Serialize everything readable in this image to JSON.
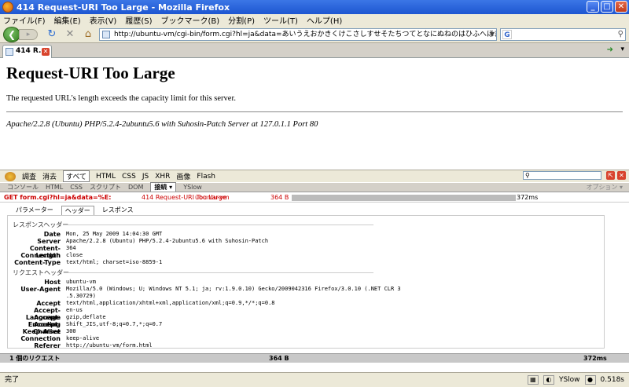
{
  "window": {
    "title": "414 Request-URI Too Large - Mozilla Firefox",
    "min": "_",
    "max": "□",
    "close": "✕"
  },
  "menu": [
    "ファイル(F)",
    "編集(E)",
    "表示(V)",
    "履歴(S)",
    "ブックマーク(B)",
    "分割(P)",
    "ツール(T)",
    "ヘルプ(H)"
  ],
  "nav": {
    "back": "❮",
    "forward": "▸",
    "reload": "↻",
    "stop": "✕",
    "home": "⌂",
    "url": "http://ubuntu-vm/cgi-bin/form.cgi?hl=ja&data=あいうえおかきくけこさしすせそたちつてとなにぬねのはひふへほまみむめもやゆよわをんあいうえおかきくけこさ",
    "search_placeholder": "",
    "search_engine": "G"
  },
  "tab": {
    "label": "414 R...",
    "close": "✕"
  },
  "page": {
    "heading": "Request-URI Too Large",
    "message": "The requested URL's length exceeds the capacity limit for this server.",
    "footer": "Apache/2.2.8 (Ubuntu) PHP/5.2.4-2ubuntu5.6 with Suhosin-Patch Server at 127.0.1.1 Port 80"
  },
  "firebug": {
    "toolbar": [
      "調査",
      "消去",
      "すべて",
      "HTML",
      "CSS",
      "JS",
      "XHR",
      "画像",
      "Flash"
    ],
    "panels": [
      "コンソール",
      "HTML",
      "CSS",
      "スクリプト",
      "DOM",
      "接続 ▾",
      "YSlow"
    ],
    "options": "オプション ▾",
    "request": {
      "method_url": "GET form.cgi?hl=ja&data=%E:",
      "status": "414 Request-URI Too Large",
      "domain": "ubuntu-vm",
      "size": "364 B",
      "time": "372ms"
    },
    "subtabs": [
      "パラメーター",
      "ヘッダー",
      "レスポンス"
    ],
    "response_title": "レスポンスヘッダー",
    "response_headers": [
      {
        "k": "Date",
        "v": "Mon, 25 May 2009 14:04:30 GMT"
      },
      {
        "k": "Server",
        "v": "Apache/2.2.8 (Ubuntu) PHP/5.2.4-2ubuntu5.6 with Suhosin-Patch"
      },
      {
        "k": "Content-Length",
        "v": "364"
      },
      {
        "k": "Connection",
        "v": "close"
      },
      {
        "k": "Content-Type",
        "v": "text/html; charset=iso-8859-1"
      }
    ],
    "request_title": "リクエストヘッダー",
    "request_headers": [
      {
        "k": "Host",
        "v": "ubuntu-vm"
      },
      {
        "k": "User-Agent",
        "v": "Mozilla/5.0 (Windows; U; Windows NT 5.1; ja; rv:1.9.0.10) Gecko/2009042316 Firefox/3.0.10 (.NET CLR 3"
      },
      {
        "k": "",
        "v": ".5.30729)"
      },
      {
        "k": "Accept",
        "v": "text/html,application/xhtml+xml,application/xml;q=0.9,*/*;q=0.8"
      },
      {
        "k": "Accept-Language",
        "v": "en-us"
      },
      {
        "k": "Accept-Encoding",
        "v": "gzip,deflate"
      },
      {
        "k": "Accept-Charset",
        "v": "Shift_JIS,utf-8;q=0.7,*;q=0.7"
      },
      {
        "k": "Keep-Alive",
        "v": "300"
      },
      {
        "k": "Connection",
        "v": "keep-alive"
      },
      {
        "k": "Referer",
        "v": "http://ubuntu-vm/form.html"
      }
    ],
    "footer": {
      "count": "1 個のリクエスト",
      "size": "364 B",
      "time": "372ms"
    }
  },
  "status": {
    "text": "完了",
    "yslow": "YSlow",
    "time": "0.518s"
  }
}
